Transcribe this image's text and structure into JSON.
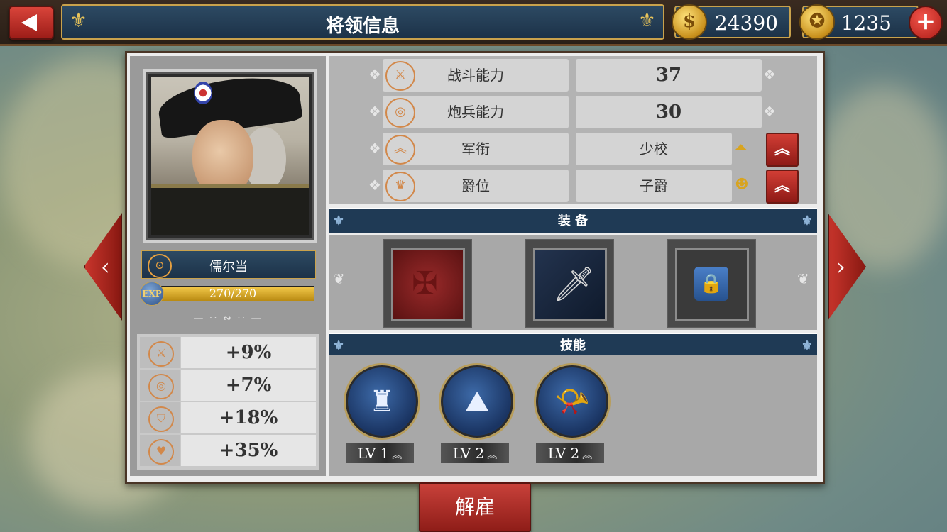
{
  "header": {
    "title": "将领信息",
    "gold": "24390",
    "medals": "1235",
    "plus_label": "+"
  },
  "general": {
    "name": "儒尔当",
    "exp_label": "EXP",
    "exp_text": "270/270",
    "exp_fraction": 1.0
  },
  "bonuses": [
    {
      "icon": "swords-plus-icon",
      "value": "+9%"
    },
    {
      "icon": "cannon-plus-icon",
      "value": "+7%"
    },
    {
      "icon": "shield-plus-icon",
      "value": "+18%"
    },
    {
      "icon": "heart-plus-icon",
      "value": "+35%"
    }
  ],
  "stats": [
    {
      "label": "战斗能力",
      "value": "37",
      "icon": "crossed-swords-icon"
    },
    {
      "label": "炮兵能力",
      "value": "30",
      "icon": "cannon-icon"
    },
    {
      "label": "军衔",
      "value": "少校",
      "icon": "chevron-rank-icon",
      "upgrade": true
    },
    {
      "label": "爵位",
      "value": "子爵",
      "icon": "crown-icon",
      "upgrade": true
    }
  ],
  "equipment": {
    "title": "装  备",
    "slots": [
      "red-emblem-item",
      "dagger-item",
      "locked-slot"
    ]
  },
  "skills": {
    "title": "技能",
    "items": [
      {
        "icon": "fortress-icon",
        "level": "LV 1"
      },
      {
        "icon": "mountain-icon",
        "level": "LV 2"
      },
      {
        "icon": "bugle-icon",
        "level": "LV 2"
      }
    ]
  },
  "actions": {
    "dismiss": "解雇"
  },
  "colors": {
    "accent_red": "#b3261e",
    "panel_blue": "#1f3a55",
    "gold": "#c9a24c",
    "stat_orange": "#d2884a"
  }
}
